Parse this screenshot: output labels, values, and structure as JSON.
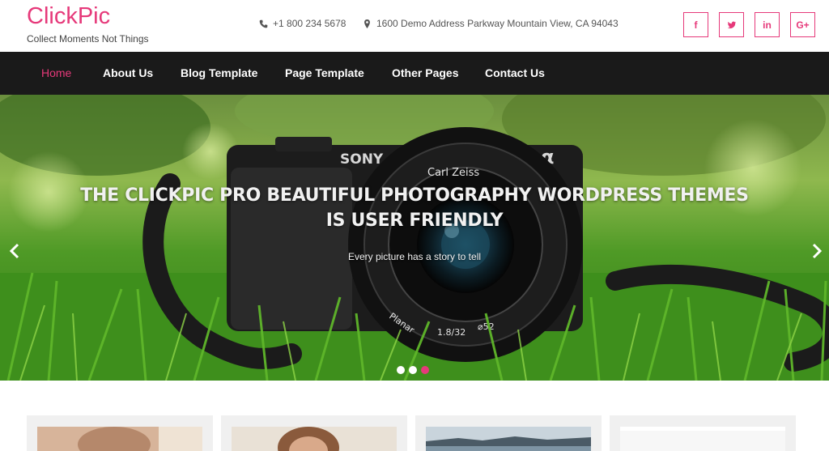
{
  "site": {
    "title": "ClickPic",
    "tagline": "Collect Moments Not Things",
    "brand_color": "#e6397a"
  },
  "contact": {
    "phone": "+1 800 234 5678",
    "address": "1600 Demo Address Parkway Mountain View, CA 94043",
    "phone_icon": "phone-icon",
    "address_icon": "map-marker-icon"
  },
  "socials": [
    {
      "icon": "facebook-icon",
      "glyph": "f"
    },
    {
      "icon": "twitter-icon",
      "glyph": "t"
    },
    {
      "icon": "linkedin-icon",
      "glyph": "in"
    },
    {
      "icon": "google-plus-icon",
      "glyph": "G+"
    }
  ],
  "nav": {
    "items": [
      {
        "label": "Home",
        "active": true
      },
      {
        "label": "About Us"
      },
      {
        "label": "Blog Template"
      },
      {
        "label": "Page Template"
      },
      {
        "label": "Other Pages"
      },
      {
        "label": "Contact Us"
      }
    ]
  },
  "slider": {
    "title_line1": "THE CLICKPIC PRO BEAUTIFUL PHOTOGRAPHY WORDPRESS THEMES",
    "title_line2": "IS USER FRIENDLY",
    "subtitle": "Every picture has a story to tell",
    "slide_count": 3,
    "active_slide": 3,
    "camera_brand": "SONY",
    "lens_brand": "Carl Zeiss",
    "lens_model": "Planar",
    "lens_aperture": "1.8/32",
    "lens_filter": "⌀52",
    "mount_mark": "α"
  },
  "cards": {
    "count": 4
  }
}
